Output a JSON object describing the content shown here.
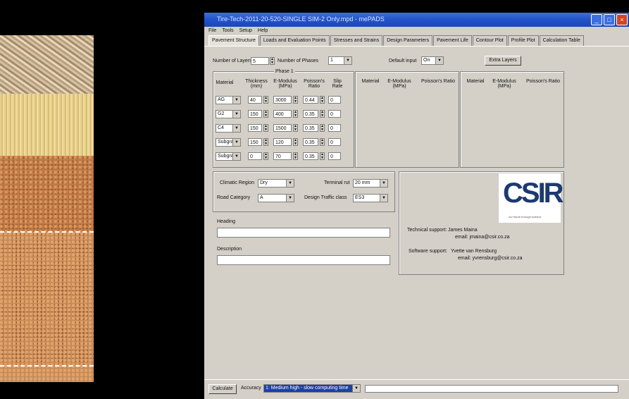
{
  "window": {
    "title": "Tire-Tech-2011-20-520-SINGLE SIM-2 Only.mpd - mePADS"
  },
  "menu": [
    "File",
    "Tools",
    "Setup",
    "Help"
  ],
  "tabs": [
    "Pavement Structure",
    "Loads and Evaluation Points",
    "Stresses and Strains",
    "Design Parameters",
    "Pavement Life",
    "Contour Plot",
    "Profile Plot",
    "Calculation Table"
  ],
  "top": {
    "layers_label": "Number of Layers",
    "layers_value": "5",
    "phases_label": "Number of Phases",
    "phases_value": "1",
    "default_label": "Default input",
    "default_value": "On",
    "extra_button": "Extra Layers"
  },
  "phase1": {
    "title": "Phase 1",
    "headers": {
      "material": "Material",
      "thickness": "Thickness (mm)",
      "emod": "E-Modulus (MPa)",
      "poisson": "Poisson's Ratio",
      "slip": "Slip Rate"
    },
    "rows": [
      {
        "material": "AG",
        "thickness": "40",
        "emod": "3000",
        "poisson": "0.44",
        "slip": "0"
      },
      {
        "material": "G2",
        "thickness": "150",
        "emod": "400",
        "poisson": "0.35",
        "slip": "0"
      },
      {
        "material": "C4",
        "thickness": "150",
        "emod": "1500",
        "poisson": "0.35",
        "slip": "0"
      },
      {
        "material": "Subgra",
        "thickness": "150",
        "emod": "120",
        "poisson": "0.35",
        "slip": "0"
      },
      {
        "material": "Subgra",
        "thickness": "0",
        "emod": "70",
        "poisson": "0.35",
        "slip": "0"
      }
    ]
  },
  "phase2": {
    "material": "Material",
    "emod": "E-Modulus (MPa)",
    "poisson": "Poisson's Ratio"
  },
  "phase3": {
    "material": "Material",
    "emod": "E-Modulus (MPa)",
    "poisson": "Poisson's Ratio"
  },
  "climate": {
    "region_label": "Climatic Region",
    "region_value": "Dry",
    "road_label": "Road Category",
    "road_value": "A",
    "rut_label": "Terminal rut",
    "rut_value": "20 mm",
    "traffic_label": "Design Traffic class",
    "traffic_value": "ES3"
  },
  "heading": {
    "label": "Heading",
    "value": ""
  },
  "description": {
    "label": "Description",
    "value": ""
  },
  "logo": {
    "text": "CSIR",
    "tagline": "our future through science"
  },
  "support": {
    "tech_label": "Technical support:",
    "tech_name": "James Maina",
    "tech_email": "email: jmaina@csir.co.za",
    "soft_label": "Software support:",
    "soft_name": "Yvette van Rensburg",
    "soft_email": "email: yvrensburg@csir.co.za"
  },
  "status": {
    "calculate": "Calculate",
    "accuracy_label": "Accuracy",
    "accuracy_value": "1: Medium high - slow computing time"
  },
  "colors": {
    "titlebar": "#2253c9",
    "selection": "#1c3fa8"
  }
}
